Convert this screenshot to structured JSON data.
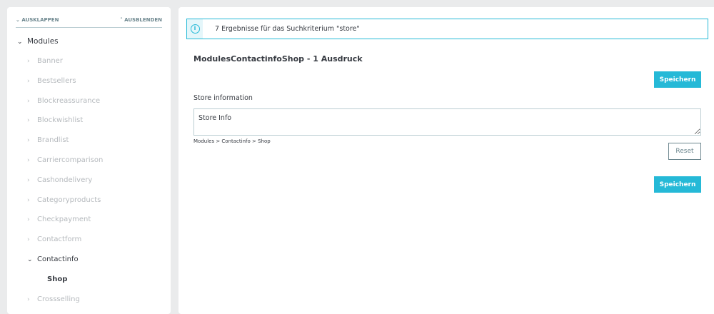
{
  "sidebar": {
    "expand_label": "AUSKLAPPEN",
    "collapse_label": "AUSBLENDEN",
    "root": "Modules",
    "items": [
      "Banner",
      "Bestsellers",
      "Blockreassurance",
      "Blockwishlist",
      "Brandlist",
      "Carriercomparison",
      "Cashondelivery",
      "Categoryproducts",
      "Checkpayment",
      "Contactform",
      "Contactinfo",
      "Crossselling"
    ],
    "selected_child": "Shop"
  },
  "main": {
    "alert": "7 Ergebnisse für das Suchkriterium \"store\"",
    "section_title": "ModulesContactinfoShop - 1 Ausdruck",
    "save_label": "Speichern",
    "field_label": "Store information",
    "field_value": "Store Info",
    "field_path": "Modules > Contactinfo > Shop",
    "reset_label": "Reset"
  }
}
